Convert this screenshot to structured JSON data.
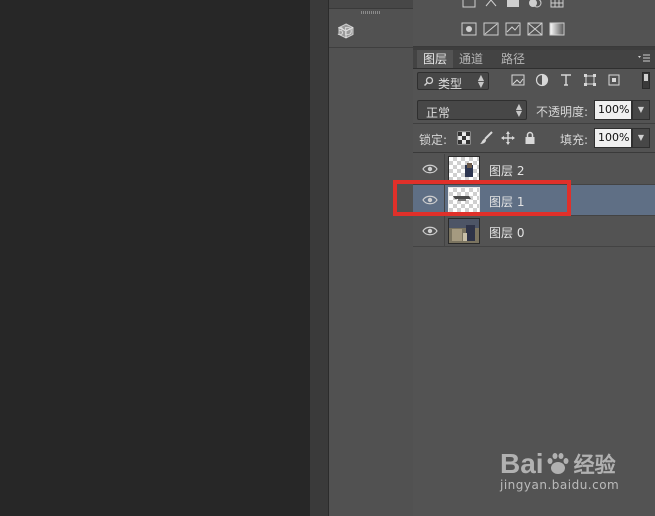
{
  "dock": {
    "item_3d_label": "3D"
  },
  "layers_panel": {
    "tabs": [
      {
        "label": "图层",
        "active": true
      },
      {
        "label": "通道",
        "active": false
      },
      {
        "label": "路径",
        "active": false
      }
    ],
    "filter_kind": "类型",
    "blend_mode": "正常",
    "opacity_label": "不透明度:",
    "opacity_value": "100%",
    "lock_label": "锁定:",
    "fill_label": "填充:",
    "fill_value": "100%",
    "layers": [
      {
        "name": "图层 2",
        "visible": true,
        "selected": false,
        "thumbnail": "transparent-with-image"
      },
      {
        "name": "图层 1",
        "visible": true,
        "selected": true,
        "thumbnail": "transparent-with-image"
      },
      {
        "name": "图层 0",
        "visible": true,
        "selected": false,
        "thumbnail": "photo"
      }
    ]
  },
  "annotation": {
    "color": "#e0302a"
  },
  "watermark": {
    "brand": "Bai",
    "brand_suffix": "经验",
    "url": "jingyan.baidu.com"
  },
  "colors": {
    "panel_bg": "#535353",
    "selected_row": "#5f6f85",
    "canvas_bg": "#272727"
  }
}
